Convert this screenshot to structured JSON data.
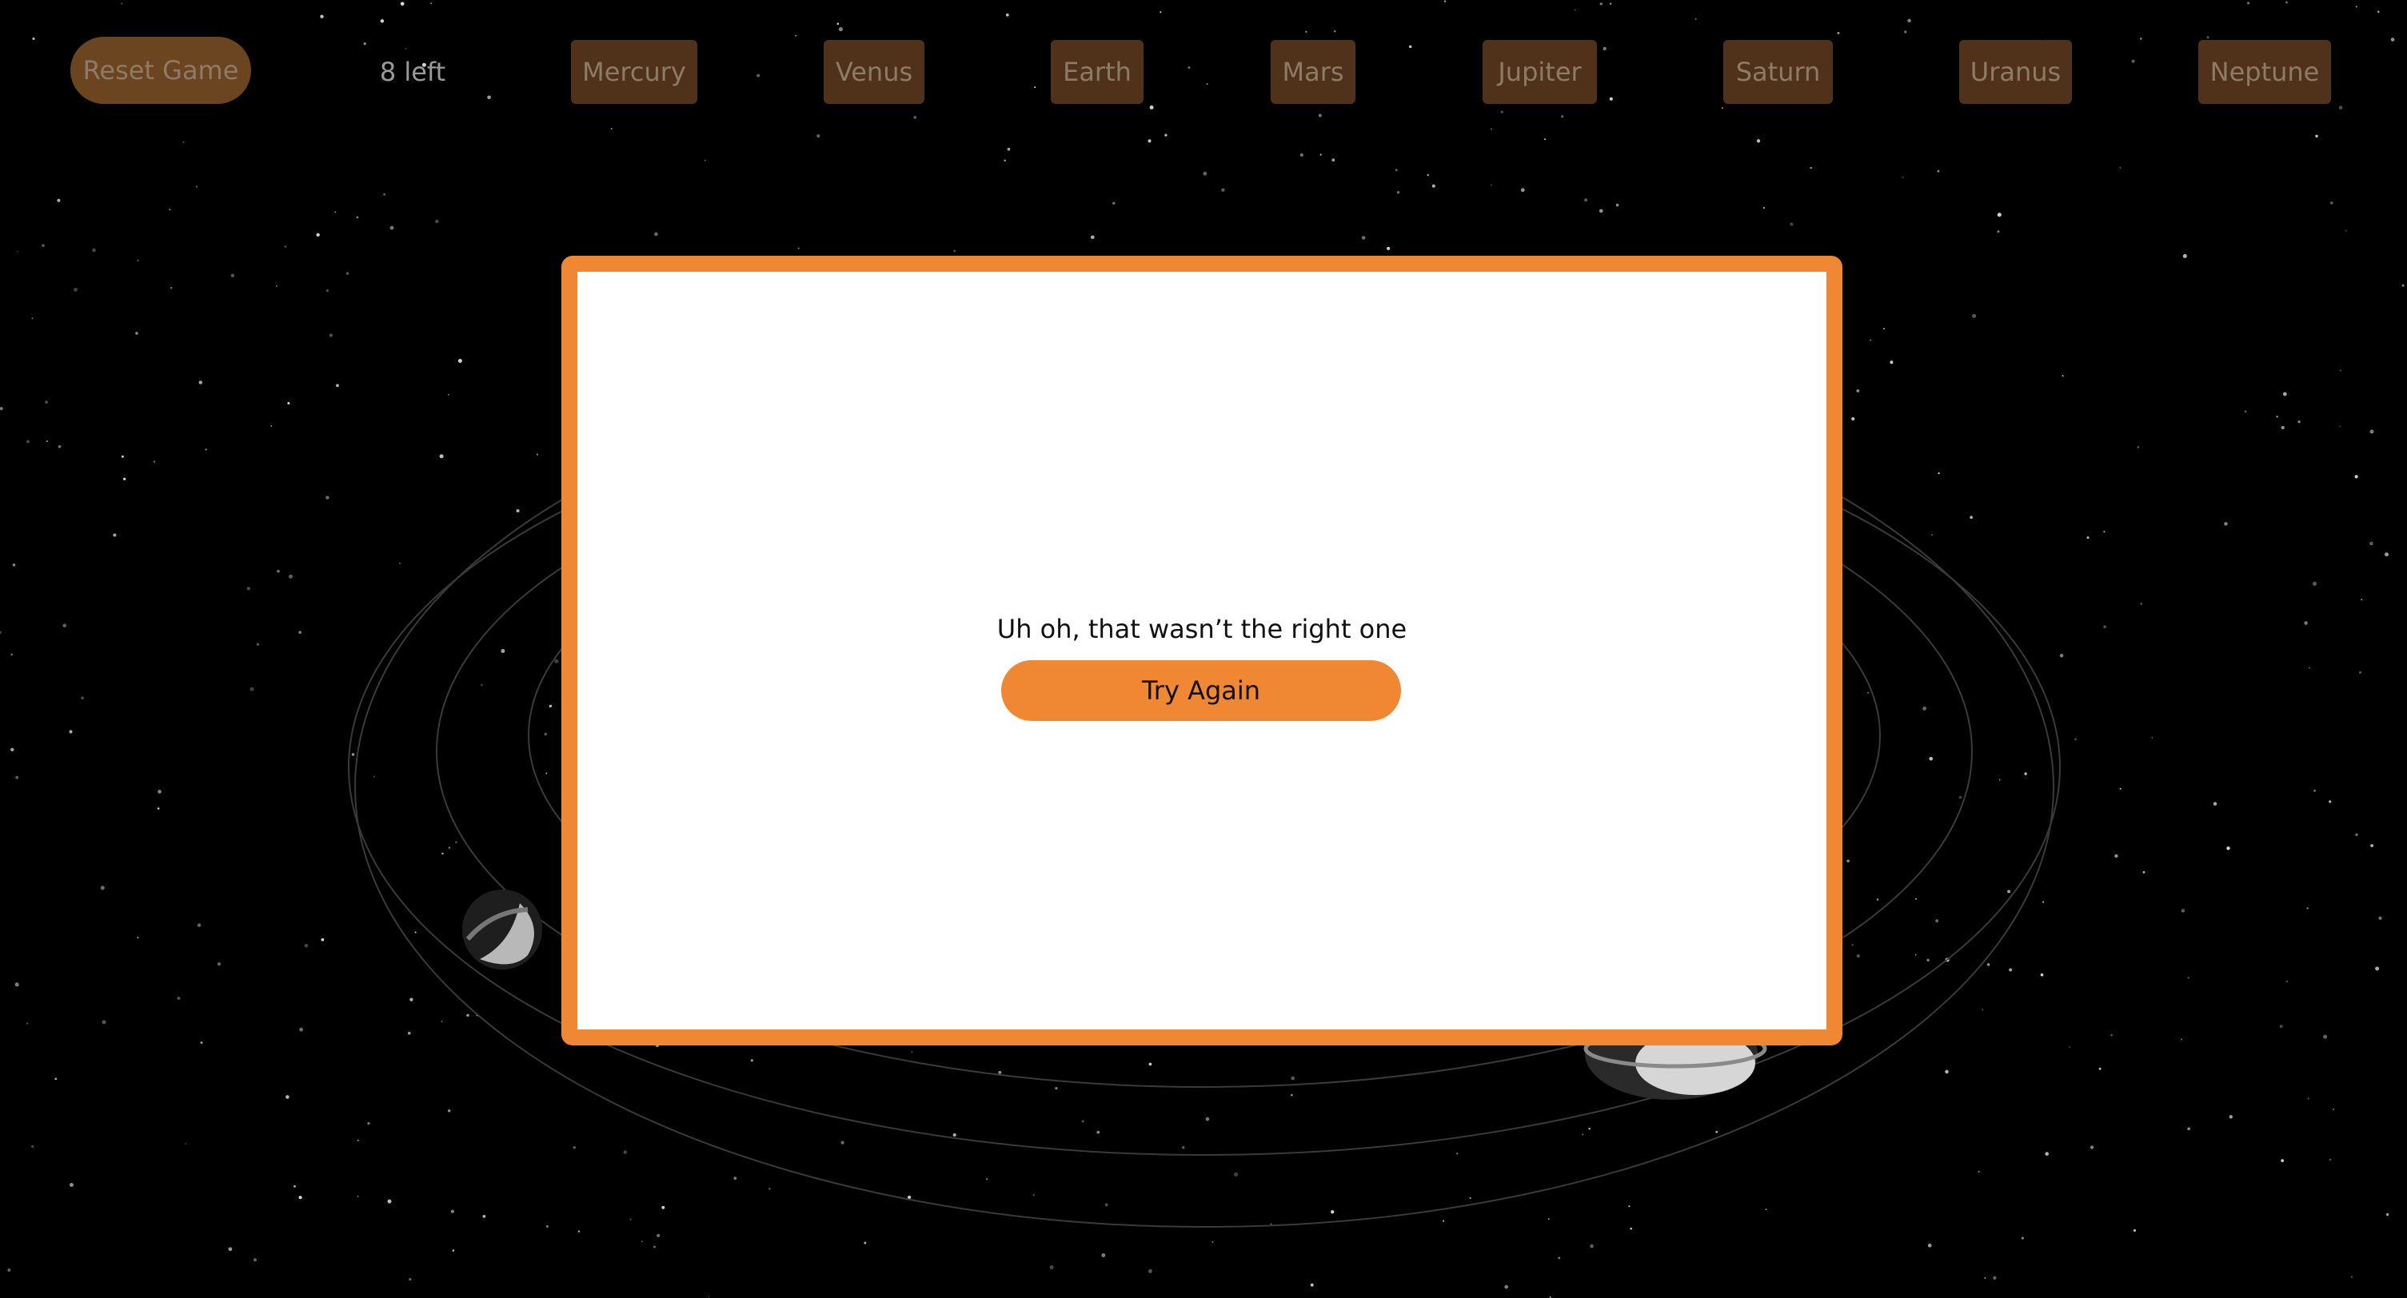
{
  "topbar": {
    "reset_label": "Reset Game",
    "remaining": "8 left",
    "planets": [
      "Mercury",
      "Venus",
      "Earth",
      "Mars",
      "Jupiter",
      "Saturn",
      "Uranus",
      "Neptune"
    ]
  },
  "modal": {
    "message": "Uh oh, that wasn’t the right one",
    "button_label": "Try Again"
  },
  "colors": {
    "background": "#000000",
    "accent": "#f08833",
    "dimmed_button": "#50321a",
    "reset_button": "#6b4420",
    "modal_surface": "#ffffff"
  },
  "icons": [
    "planet-icon",
    "ringed-planet-icon"
  ]
}
